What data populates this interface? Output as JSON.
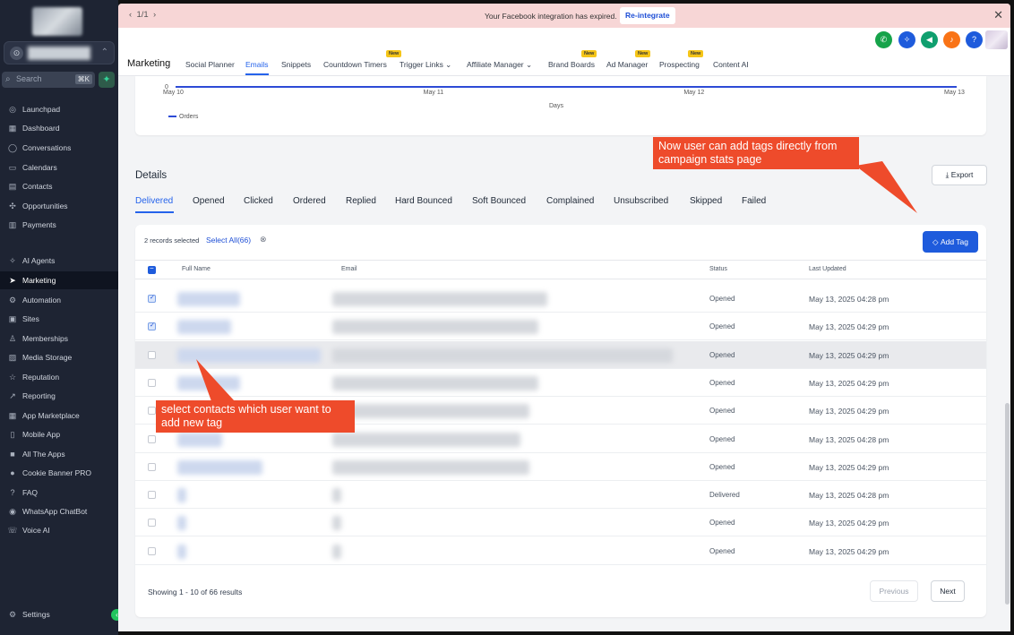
{
  "sidebar": {
    "search_placeholder": "Search",
    "search_shortcut": "⌘K",
    "items": [
      {
        "label": "Launchpad",
        "icon": "◎"
      },
      {
        "label": "Dashboard",
        "icon": "▦"
      },
      {
        "label": "Conversations",
        "icon": "◯"
      },
      {
        "label": "Calendars",
        "icon": "▭"
      },
      {
        "label": "Contacts",
        "icon": "▤"
      },
      {
        "label": "Opportunities",
        "icon": "✣"
      },
      {
        "label": "Payments",
        "icon": "▥"
      },
      {
        "label": "AI Agents",
        "icon": "✧"
      },
      {
        "label": "Marketing",
        "icon": "➤"
      },
      {
        "label": "Automation",
        "icon": "⚙"
      },
      {
        "label": "Sites",
        "icon": "▣"
      },
      {
        "label": "Memberships",
        "icon": "♙"
      },
      {
        "label": "Media Storage",
        "icon": "▨"
      },
      {
        "label": "Reputation",
        "icon": "☆"
      },
      {
        "label": "Reporting",
        "icon": "↗"
      },
      {
        "label": "App Marketplace",
        "icon": "▦"
      },
      {
        "label": "Mobile App",
        "icon": "▯"
      },
      {
        "label": "All The Apps",
        "icon": "■"
      },
      {
        "label": "Cookie Banner PRO",
        "icon": "●"
      },
      {
        "label": "FAQ",
        "icon": "?"
      },
      {
        "label": "WhatsApp ChatBot",
        "icon": "◉"
      },
      {
        "label": "Voice AI",
        "icon": "☏"
      },
      {
        "label": "Settings",
        "icon": "⚙"
      }
    ]
  },
  "banner": {
    "pager": "1/1",
    "message": "Your Facebook integration has expired.",
    "button": "Re-integrate"
  },
  "header": {
    "title": "Marketing",
    "tabs": [
      {
        "label": "Social Planner"
      },
      {
        "label": "Emails"
      },
      {
        "label": "Snippets"
      },
      {
        "label": "Countdown Timers",
        "badge": "New"
      },
      {
        "label": "Trigger Links ⌄"
      },
      {
        "label": "Affiliate Manager ⌄"
      },
      {
        "label": "Brand Boards",
        "badge": "New"
      },
      {
        "label": "Ad Manager",
        "badge": "New"
      },
      {
        "label": "Prospecting",
        "badge": "New"
      },
      {
        "label": "Content AI"
      }
    ]
  },
  "colors": {
    "primary": "#1e5bdc",
    "callout": "#ee4b2b",
    "sidebar": "#1e2433",
    "banner": "#f7d6d6"
  },
  "chart_data": {
    "type": "line",
    "x": [
      "May 10",
      "May 11",
      "May 12",
      "May 13"
    ],
    "series": [
      {
        "name": "Orders",
        "values": [
          0,
          0,
          0,
          0
        ]
      }
    ],
    "ytick": "0",
    "xlabel": "Days",
    "legend": "bottom-left"
  },
  "details": {
    "title": "Details",
    "export": "Export",
    "tabs": [
      "Delivered",
      "Opened",
      "Clicked",
      "Ordered",
      "Replied",
      "Hard Bounced",
      "Soft Bounced",
      "Complained",
      "Unsubscribed",
      "Skipped",
      "Failed"
    ],
    "selection": {
      "text": "2 records selected",
      "select_all": "Select All(66)"
    },
    "add_tag": "Add Tag",
    "columns": [
      "Full Name",
      "Email",
      "Status",
      "Last Updated"
    ],
    "rows": [
      {
        "status": "Opened",
        "updated": "May 13, 2025 04:28 pm",
        "checked": true
      },
      {
        "status": "Opened",
        "updated": "May 13, 2025 04:29 pm",
        "checked": true
      },
      {
        "status": "Opened",
        "updated": "May 13, 2025 04:29 pm",
        "checked": false
      },
      {
        "status": "Opened",
        "updated": "May 13, 2025 04:29 pm",
        "checked": false
      },
      {
        "status": "Opened",
        "updated": "May 13, 2025 04:29 pm",
        "checked": false
      },
      {
        "status": "Opened",
        "updated": "May 13, 2025 04:28 pm",
        "checked": false
      },
      {
        "status": "Opened",
        "updated": "May 13, 2025 04:29 pm",
        "checked": false
      },
      {
        "status": "Delivered",
        "updated": "May 13, 2025 04:28 pm",
        "checked": false
      },
      {
        "status": "Opened",
        "updated": "May 13, 2025 04:29 pm",
        "checked": false
      },
      {
        "status": "Opened",
        "updated": "May 13, 2025 04:29 pm",
        "checked": false
      }
    ],
    "showing": "Showing 1 - 10 of 66 results",
    "previous": "Previous",
    "next": "Next"
  },
  "annotations": {
    "top": "Now user can add tags directly from campaign stats page",
    "bottom": "select contacts which user want to add new tag"
  }
}
